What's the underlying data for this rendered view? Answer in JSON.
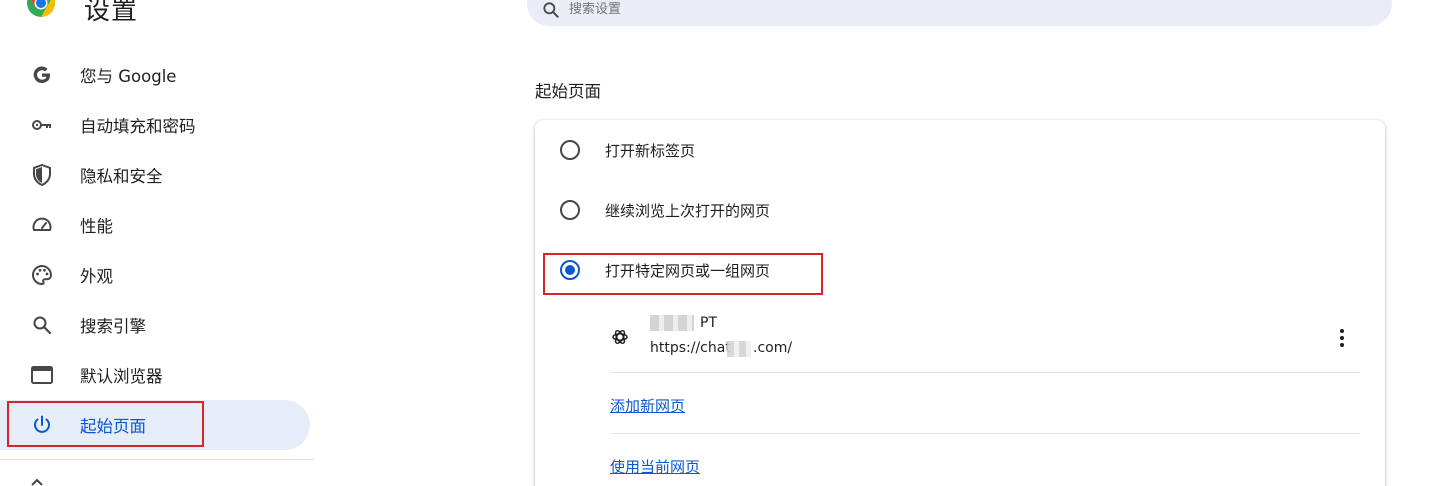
{
  "header": {
    "title": "设置",
    "search_placeholder": "搜索设置",
    "logo_icon": "chrome-logo-icon"
  },
  "sidebar": {
    "items": [
      {
        "label": "您与 Google",
        "icon": "google-g-icon"
      },
      {
        "label": "自动填充和密码",
        "icon": "key-icon"
      },
      {
        "label": "隐私和安全",
        "icon": "shield-icon"
      },
      {
        "label": "性能",
        "icon": "speedometer-icon"
      },
      {
        "label": "外观",
        "icon": "palette-icon"
      },
      {
        "label": "搜索引擎",
        "icon": "search-icon"
      },
      {
        "label": "默认浏览器",
        "icon": "browser-window-icon"
      },
      {
        "label": "起始页面",
        "icon": "power-icon",
        "active": true
      }
    ]
  },
  "main": {
    "section_title": "起始页面",
    "options": [
      {
        "label": "打开新标签页",
        "checked": false
      },
      {
        "label": "继续浏览上次打开的网页",
        "checked": false
      },
      {
        "label": "打开特定网页或一组网页",
        "checked": true
      }
    ],
    "pages": [
      {
        "name": "PT",
        "url_prefix": "https://chat",
        "url_suffix": ".com/",
        "icon": "openai-logo-icon"
      }
    ],
    "add_page_link": "添加新网页",
    "use_current_link": "使用当前网页"
  },
  "colors": {
    "accent": "#0b57d0",
    "active_bg": "#e6ecf8",
    "highlight_box": "#d5242a",
    "search_bg": "#e9eef6"
  }
}
